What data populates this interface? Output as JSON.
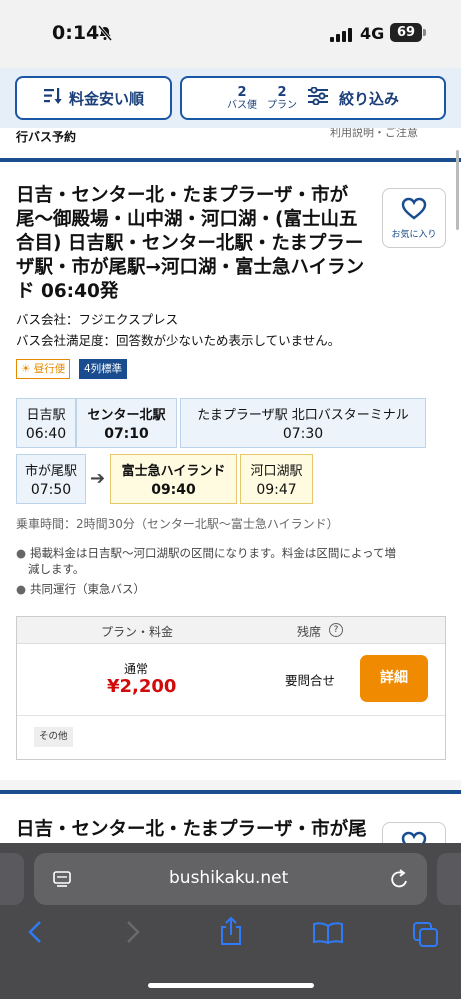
{
  "status": {
    "time": "0:14",
    "network": "4G",
    "battery": "69"
  },
  "toolbar": {
    "sort_label": "料金安い順",
    "bus_count": "2",
    "bus_unit": "バス便",
    "plan_count": "2",
    "plan_unit": "プラン",
    "filter_label": "絞り込み"
  },
  "page": {
    "breadcrumb": "行バス予約",
    "help_link": "利用説明・ご注意"
  },
  "result1": {
    "title": "日吉・センター北・たまプラーザ・市が尾〜御殿場・山中湖・河口湖・(富士山五合目) 日吉駅・センター北駅・たまプラーザ駅・市が尾駅→河口湖・富士急ハイランド 06:40発",
    "fav_label": "お気に入り",
    "company": "バス会社：フジエクスプレス",
    "satisfaction": "バス会社満足度：回答数が少ないため表示していません。",
    "tag_day": "昼行便",
    "tag_seat": "4列標準",
    "stops": [
      {
        "name": "日吉駅",
        "time": "06:40"
      },
      {
        "name": "センター北駅",
        "time": "07:10"
      },
      {
        "name": "たまプラーザ駅 北口バスターミナル",
        "time": "07:30"
      },
      {
        "name": "市が尾駅",
        "time": "07:50"
      },
      {
        "name": "富士急ハイランド",
        "time": "09:40"
      },
      {
        "name": "河口湖駅",
        "time": "09:47"
      }
    ],
    "ride_time": "乗車時間：2時間30分（センター北駅〜富士急ハイランド）",
    "notes": [
      "掲載料金は日吉駅〜河口湖駅の区間になります。料金は区間によって増",
      "減します。",
      "共同運行（東急バス）"
    ],
    "plan_header": "プラン・料金",
    "seat_header": "残席",
    "plan_name": "通常",
    "price": "¥2,200",
    "seat_status": "要問合せ",
    "detail_button": "詳細",
    "other_tag": "その他"
  },
  "result2": {
    "title": "日吉・センター北・たまプラーザ・市が尾"
  },
  "browser": {
    "url": "bushikaku.net"
  }
}
